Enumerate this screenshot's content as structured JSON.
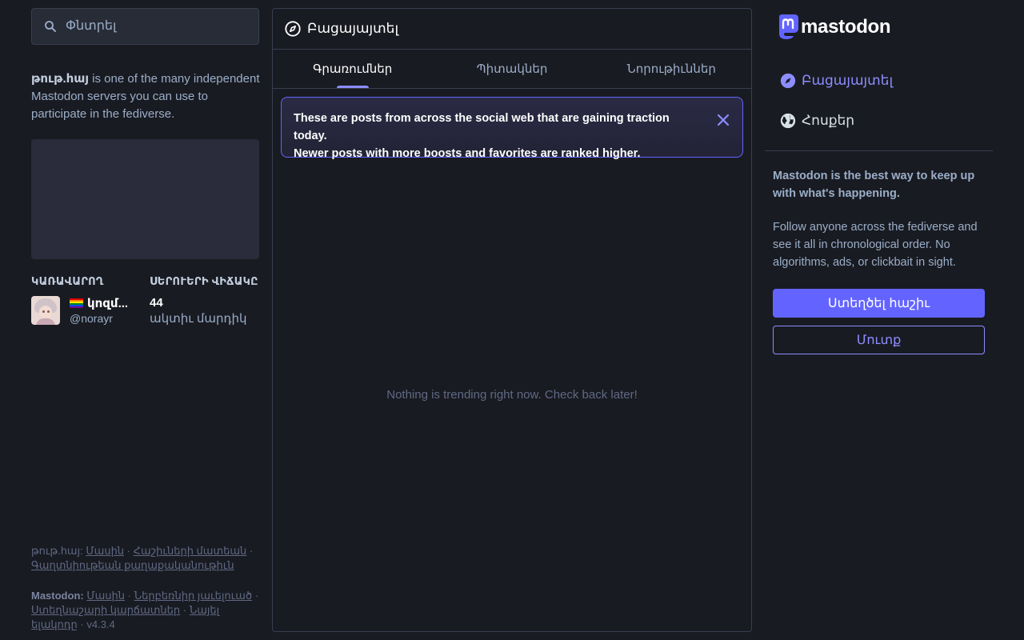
{
  "search": {
    "placeholder": "Փնտրել"
  },
  "server": {
    "domain": "թութ.հայ",
    "description_rest": " is one of the many independent Mastodon servers you can use to participate in the fediverse.",
    "administrator_heading": "ԿԱՌԱՎԱՐՈՂ",
    "stats_heading": "ՍԵՐՈՒԵՐԻ ՎԻՃԱԿԸ",
    "admin_name": "կոզմ...",
    "admin_handle": "@norayr",
    "active_users_count": "44",
    "active_users_label": "ակտիւ մարդիկ"
  },
  "footer": {
    "server_label": "թութ.հայ:",
    "server_links": [
      "Մասին",
      "Հաշիւների մատեան",
      "Գաղտնիութեան քաղաքականութիւն"
    ],
    "mastodon_label": "Mastodon:",
    "mastodon_links": [
      "Մասին",
      "Ներբեռնիր յաւելուած",
      "Ստեղնաշարի կարճատներ",
      "Նայել ելակոդը"
    ],
    "version": "v4.3.4",
    "separator": "·"
  },
  "explore": {
    "title": "Բացայայտել",
    "tabs": [
      {
        "label": "Գրառումներ",
        "active": true
      },
      {
        "label": "Պիտակներ",
        "active": false
      },
      {
        "label": "Նորութիւններ",
        "active": false
      }
    ],
    "notice_line1": "These are posts from across the social web that are gaining traction today.",
    "notice_line2": "Newer posts with more boosts and favorites are ranked higher.",
    "empty_message": "Nothing is trending right now. Check back later!"
  },
  "sidebar": {
    "logo_text": "mastodon",
    "nav": [
      {
        "label": "Բացայայտել",
        "icon": "explore-icon",
        "active": true
      },
      {
        "label": "Հոսքեր",
        "icon": "globe-icon",
        "active": false
      }
    ],
    "promo_heading": "Mastodon is the best way to keep up with what's happening.",
    "promo_body": "Follow anyone across the fediverse and see it all in chronological order. No algorithms, ads, or clickbait in sight.",
    "signup_label": "Ստեղծել հաշիւ",
    "login_label": "Մուտք"
  },
  "colors": {
    "background": "#191b22",
    "accent": "#6364ff",
    "accent_light": "#8c8dff",
    "border": "#393f4f"
  }
}
